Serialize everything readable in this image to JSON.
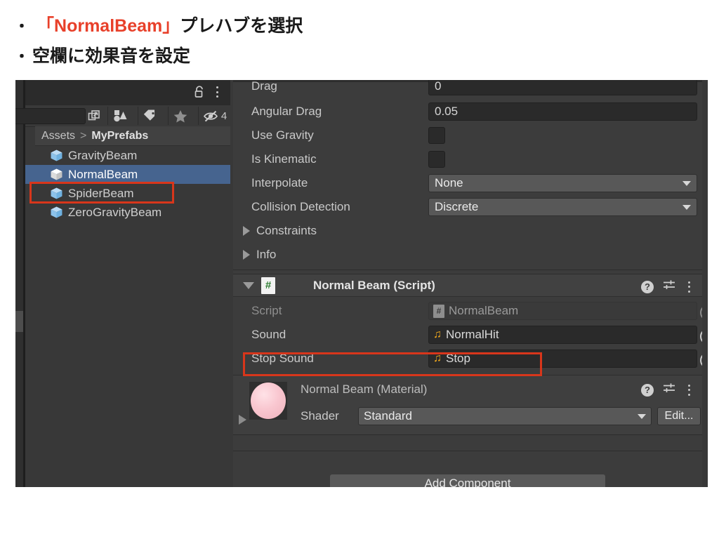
{
  "slide": {
    "bullet1": {
      "marker": "・",
      "highlight": "「NormalBeam」",
      "rest": " プレハブを選択"
    },
    "bullet2": {
      "marker": "・",
      "text": "空欄に効果音を設定"
    },
    "highlight_color": "#e8402a"
  },
  "project_panel": {
    "title_icons": [
      "lock-icon",
      "kebab-menu-icon"
    ],
    "toolbar": {
      "search_value": "",
      "search_placeholder": "",
      "buttons": [
        "popout-icon",
        "shapes-filter-icon",
        "tag-filter-icon",
        "favorite-star-icon",
        "hidden-eye-icon"
      ],
      "hidden_count": "4"
    },
    "breadcrumb": {
      "root": "Assets",
      "separator": ">",
      "leaf": "MyPrefabs"
    },
    "assets": [
      {
        "name": "GravityBeam",
        "selected": false
      },
      {
        "name": "NormalBeam",
        "selected": true
      },
      {
        "name": "SpiderBeam",
        "selected": false
      },
      {
        "name": "ZeroGravityBeam",
        "selected": false
      }
    ],
    "selection_color": "#46648f"
  },
  "inspector": {
    "rigidbody_props": [
      {
        "label": "Drag",
        "value": "0",
        "type": "text"
      },
      {
        "label": "Angular Drag",
        "value": "0.05",
        "type": "text"
      },
      {
        "label": "Use Gravity",
        "value": "",
        "type": "checkbox"
      },
      {
        "label": "Is Kinematic",
        "value": "",
        "type": "checkbox"
      },
      {
        "label": "Interpolate",
        "value": "None",
        "type": "dropdown"
      },
      {
        "label": "Collision Detection",
        "value": "Discrete",
        "type": "dropdown"
      }
    ],
    "foldouts": [
      {
        "label": "Constraints"
      },
      {
        "label": "Info"
      }
    ],
    "script_component": {
      "title": "Normal Beam (Script)",
      "icon_glyph": "#",
      "fields": [
        {
          "label": "Script",
          "value": "NormalBeam",
          "icon": "csharp-script-icon",
          "disabled": true
        },
        {
          "label": "Sound",
          "value": "NormalHit",
          "icon": "audio-clip-icon",
          "disabled": false
        },
        {
          "label": "Stop Sound",
          "value": "Stop",
          "icon": "audio-clip-icon",
          "disabled": false
        }
      ]
    },
    "material_component": {
      "title": "Normal Beam (Material)",
      "shader_label": "Shader",
      "shader_value": "Standard",
      "edit_label": "Edit...",
      "sphere_color": "#f9c7d0"
    },
    "add_component_label": "Add Component",
    "note_glyph": "♫",
    "help_glyph": "?"
  },
  "annotations": {
    "box_color": "#d8361b",
    "boxes": [
      "prefab-normalbeam-highlight",
      "stop-sound-row-highlight"
    ]
  }
}
